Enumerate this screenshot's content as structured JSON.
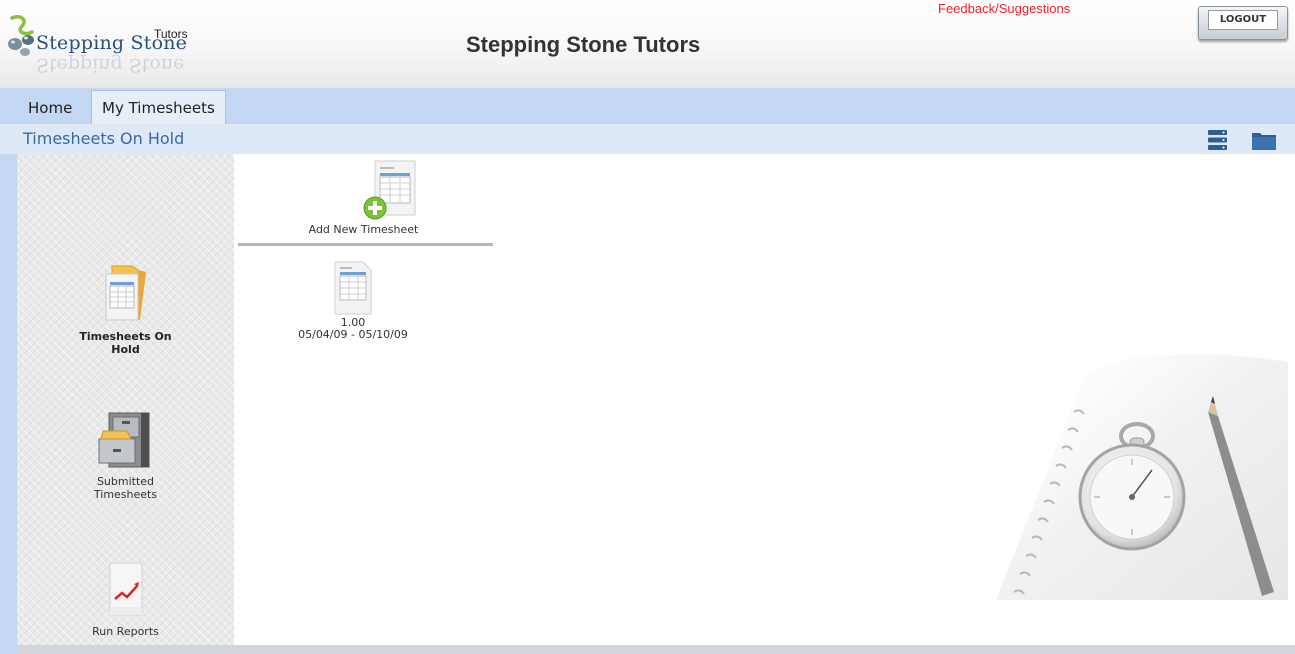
{
  "header": {
    "logo_word": "Stepping Stone",
    "logo_small": "Tutors",
    "site_title": "Stepping Stone Tutors",
    "feedback_link": "Feedback/Suggestions",
    "logout_label": "LOGOUT"
  },
  "tabs": [
    {
      "label": "Home",
      "active": false
    },
    {
      "label": "My Timesheets",
      "active": true
    }
  ],
  "section": {
    "title": "Timesheets On Hold",
    "icons": [
      "list-view-icon",
      "folder-view-icon"
    ]
  },
  "sidebar": {
    "items": [
      {
        "label": "Timesheets On Hold",
        "icon": "timesheets-on-hold-icon",
        "active": true
      },
      {
        "label": "Submitted Timesheets",
        "icon": "filing-cabinet-icon",
        "active": false
      },
      {
        "label": "Run Reports",
        "icon": "report-chart-icon",
        "active": false
      }
    ]
  },
  "content": {
    "add_new_label": "Add New Timesheet",
    "timesheets": [
      {
        "hours": "1.00",
        "date_range": "05/04/09 - 05/10/09"
      }
    ]
  },
  "colors": {
    "tab_bar": "#c3d6f2",
    "section_bar": "#dfe8f6",
    "section_title": "#346aa8",
    "feedback": "#e8232a",
    "icon_blue": "#2c5f95"
  }
}
